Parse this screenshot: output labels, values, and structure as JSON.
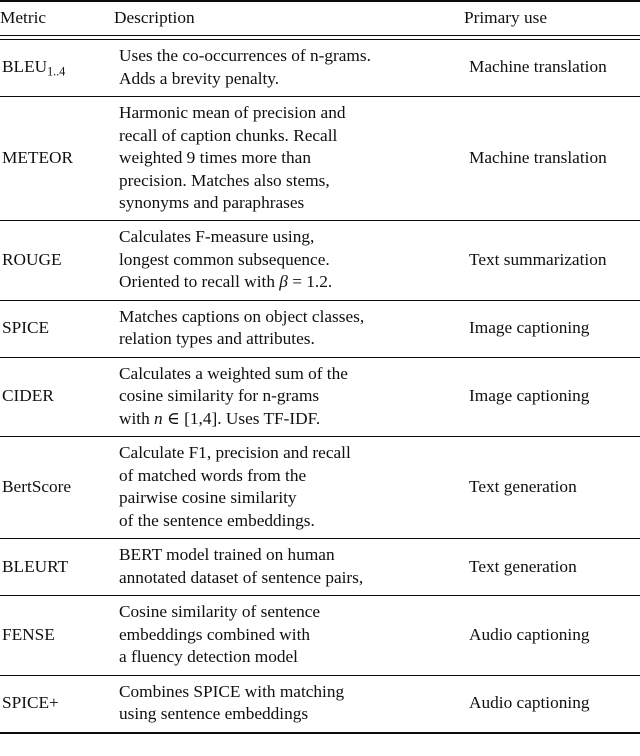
{
  "table": {
    "caption_visible": false,
    "columns": [
      {
        "key": "metric",
        "label": "Metric"
      },
      {
        "key": "description",
        "label": "Description"
      },
      {
        "key": "primary_use",
        "label": "Primary use"
      }
    ],
    "rows": [
      {
        "metric": "BLEU",
        "metric_subscript": "1..4",
        "description_lines": [
          "Uses the co-occurrences of n-grams.",
          "Adds a brevity penalty."
        ],
        "primary_use": "Machine translation"
      },
      {
        "metric": "METEOR",
        "metric_subscript": "",
        "description_lines": [
          "Harmonic mean of precision and",
          "recall of caption chunks. Recall",
          "weighted 9 times more than",
          "precision. Matches also stems,",
          "synonyms and paraphrases"
        ],
        "primary_use": "Machine translation"
      },
      {
        "metric": "ROUGE",
        "metric_subscript": "",
        "description_lines": [
          "Calculates F-measure using,",
          "longest common subsequence.",
          "Oriented to recall with β = 1.2."
        ],
        "primary_use": "Text summarization"
      },
      {
        "metric": "SPICE",
        "metric_subscript": "",
        "description_lines": [
          "Matches captions on object classes,",
          "relation types and attributes."
        ],
        "primary_use": "Image captioning"
      },
      {
        "metric": "CIDER",
        "metric_subscript": "",
        "description_lines": [
          "Calculates a weighted sum of the",
          "cosine similarity for n-grams",
          "with n ∈ [1,4]. Uses TF-IDF."
        ],
        "primary_use": "Image captioning"
      },
      {
        "metric": "BertScore",
        "metric_subscript": "",
        "description_lines": [
          "Calculate F1, precision and recall",
          "of matched words from the",
          "pairwise cosine similarity",
          "of the sentence embeddings."
        ],
        "primary_use": "Text generation"
      },
      {
        "metric": "BLEURT",
        "metric_subscript": "",
        "description_lines": [
          "BERT model trained on human",
          "annotated dataset of sentence pairs,"
        ],
        "primary_use": "Text generation"
      },
      {
        "metric": "FENSE",
        "metric_subscript": "",
        "description_lines": [
          "Cosine similarity of sentence",
          "embeddings combined with",
          "a fluency detection model"
        ],
        "primary_use": "Audio captioning"
      },
      {
        "metric": "SPICE+",
        "metric_subscript": "",
        "description_lines": [
          "Combines SPICE with matching",
          "using sentence embeddings"
        ],
        "primary_use": "Audio captioning"
      }
    ]
  },
  "style": {
    "rule_color": "#0b0b0b",
    "text_color": "#101010",
    "background": "#ffffff"
  }
}
